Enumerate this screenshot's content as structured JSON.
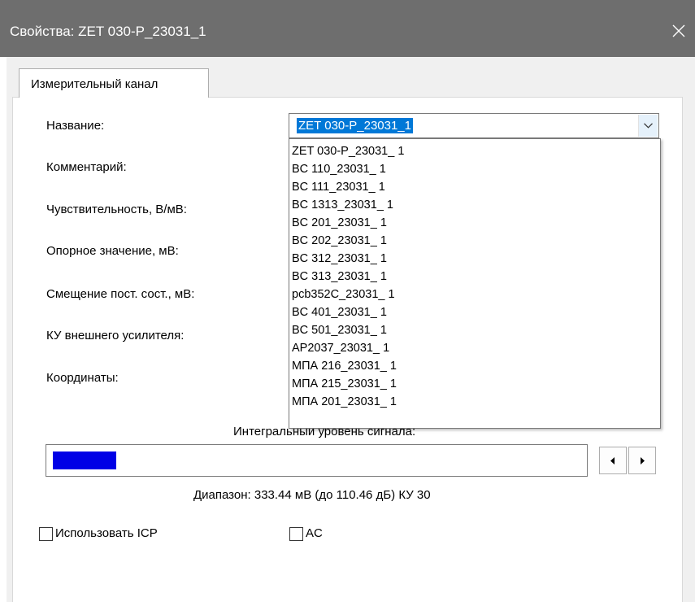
{
  "window": {
    "title": "Свойства: ZET 030-P_23031_1"
  },
  "tabs": [
    {
      "label": "Измерительный канал",
      "active": true
    }
  ],
  "form": {
    "name_label": "Название:",
    "comment_label": "Комментарий:",
    "sensitivity_label": "Чувствительность, В/мВ:",
    "reference_label": "Опорное значение, мВ:",
    "dc_offset_label": "Смещение пост. сост., мВ:",
    "amp_gain_label": "КУ внешнего усилителя:",
    "coords_label": "Координаты:"
  },
  "name_combo": {
    "value": "ZET 030-P_23031_1",
    "options": [
      "ZET 030-P_23031_ 1",
      "BC 110_23031_ 1",
      "BC 111_23031_ 1",
      "BC 1313_23031_ 1",
      "BC 201_23031_ 1",
      "BC 202_23031_ 1",
      "BC 312_23031_ 1",
      "BC 313_23031_ 1",
      "pcb352C_23031_ 1",
      "BC 401_23031_ 1",
      "BC 501_23031_ 1",
      "AP2037_23031_ 1",
      "МПА 216_23031_ 1",
      "МПА 215_23031_ 1",
      "МПА 201_23031_ 1"
    ]
  },
  "signal": {
    "label": "Интегральный уровень сигнала:",
    "level_fraction": 0.12,
    "fill_color": "#0000e6",
    "range_text": "Диапазон: 333.44 мВ (до 110.46 дБ) КУ 30"
  },
  "checkboxes": {
    "icp_label": "Использовать ICP",
    "icp_checked": false,
    "ac_label": "AC",
    "ac_checked": false
  },
  "colors": {
    "titlebar": "#6e6e6e",
    "selection": "#0078d7"
  }
}
